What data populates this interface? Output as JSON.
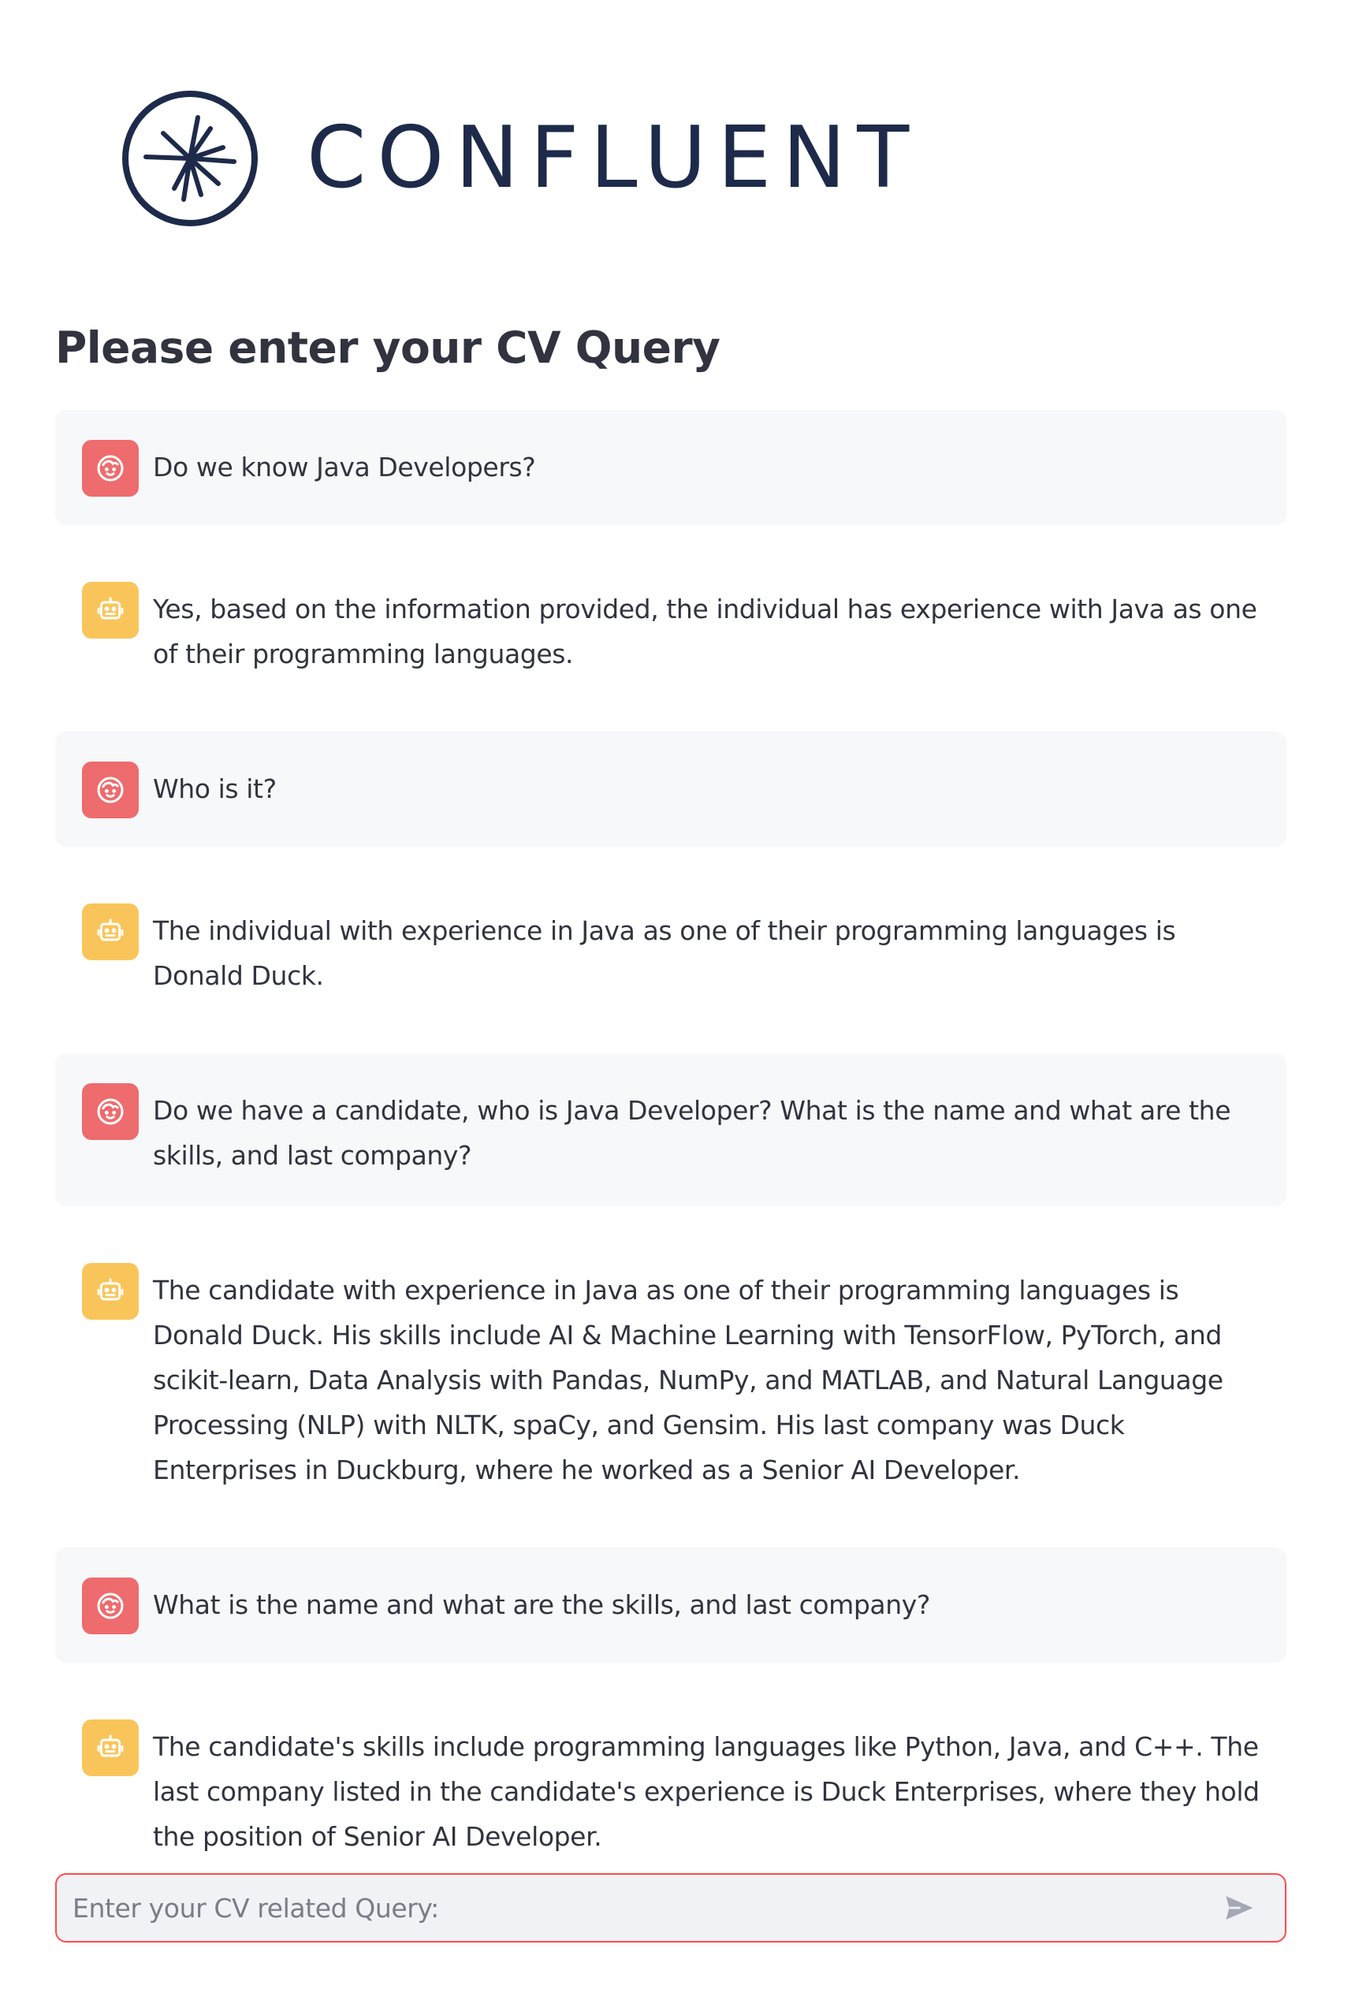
{
  "brand": {
    "name": "CONFLUENT",
    "color": "#1e2a4a"
  },
  "page_title": "Please enter your CV Query",
  "messages": [
    {
      "role": "user",
      "avatar_icon": "face-icon",
      "text": "Do we know Java Developers?"
    },
    {
      "role": "assistant",
      "avatar_icon": "robot-icon",
      "text": "Yes, based on the information provided, the individual has experience with Java as one of their programming languages."
    },
    {
      "role": "user",
      "avatar_icon": "face-icon",
      "text": "Who is it?"
    },
    {
      "role": "assistant",
      "avatar_icon": "robot-icon",
      "text": "The individual with experience in Java as one of their programming languages is Donald Duck."
    },
    {
      "role": "user",
      "avatar_icon": "face-icon",
      "text": "Do we have a candidate, who is Java Developer? What is the name and what are the skills, and last company?"
    },
    {
      "role": "assistant",
      "avatar_icon": "robot-icon",
      "text": "The candidate with experience in Java as one of their programming languages is Donald Duck. His skills include AI & Machine Learning with TensorFlow, PyTorch, and scikit-learn, Data Analysis with Pandas, NumPy, and MATLAB, and Natural Language Processing (NLP) with NLTK, spaCy, and Gensim. His last company was Duck Enterprises in Duckburg, where he worked as a Senior AI Developer."
    },
    {
      "role": "user",
      "avatar_icon": "face-icon",
      "text": "What is the name and what are the skills, and last company?"
    },
    {
      "role": "assistant",
      "avatar_icon": "robot-icon",
      "text": "The candidate's skills include programming languages like Python, Java, and C++. The last company listed in the candidate's experience is Duck Enterprises, where they hold the position of Senior AI Developer."
    }
  ],
  "input": {
    "value": "",
    "placeholder": "Enter your CV related Query:",
    "send_icon": "send-icon"
  },
  "colors": {
    "user_avatar": "#ee6b6e",
    "assistant_avatar": "#f9c55a",
    "user_bubble": "#f7f8fa",
    "input_border": "#ff4b4b",
    "input_background": "#f0f2f6"
  }
}
